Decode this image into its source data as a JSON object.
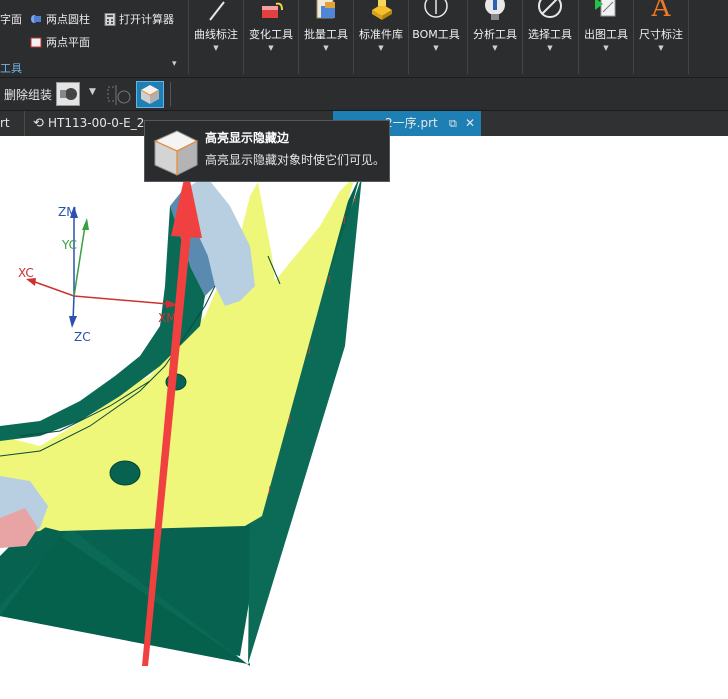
{
  "ribbon": {
    "small_items": {
      "surface": "字面",
      "two_point_cylinder": "两点圆柱",
      "open_calculator": "打开计算器",
      "two_point_plane": "两点平面"
    },
    "group_label": "工具",
    "buttons": [
      {
        "label": "曲线标注",
        "icon": "curve-dimension-icon"
      },
      {
        "label": "变化工具",
        "icon": "transform-tools-icon"
      },
      {
        "label": "批量工具",
        "icon": "batch-tools-icon"
      },
      {
        "label": "标准件库",
        "icon": "standard-parts-library-icon"
      },
      {
        "label": "BOM工具",
        "icon": "bom-tools-icon"
      },
      {
        "label": "分析工具",
        "icon": "analysis-tools-icon"
      },
      {
        "label": "选择工具",
        "icon": "selection-tools-icon"
      },
      {
        "label": "出图工具",
        "icon": "drawing-tools-icon"
      },
      {
        "label": "尺寸标注",
        "icon": "dimension-icon"
      }
    ]
  },
  "toolbar": {
    "delete_assembly": "删除组装"
  },
  "tabs": [
    {
      "label": "rt"
    },
    {
      "label": "HT113-00-0-E_2"
    },
    {
      "label": "2一序.prt",
      "active": true
    }
  ],
  "tooltip": {
    "title": "高亮显示隐藏边",
    "description": "高亮显示隐藏对象时使它们可见。"
  },
  "axes": {
    "xc": "XC",
    "yc": "YC",
    "zc": "ZC",
    "zm": "ZM",
    "xm": "XM"
  },
  "colors": {
    "ribbon_bg": "#2b2d2f",
    "accent_tab": "#1e7fb4",
    "model_yellow": "#eef77a",
    "model_green": "#07624f",
    "arrow_red": "#f04040",
    "tooltip_bg": "#2b2c2e"
  }
}
